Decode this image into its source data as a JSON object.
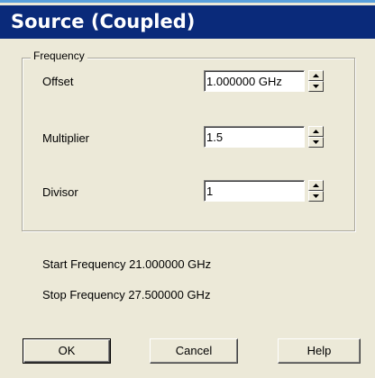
{
  "dialog": {
    "title": "Source (Coupled)"
  },
  "frequency_group": {
    "legend": "Frequency",
    "offset": {
      "label": "Offset",
      "value": "1.000000 GHz"
    },
    "multiplier": {
      "label": "Multiplier",
      "value": "1.5"
    },
    "divisor": {
      "label": "Divisor",
      "value": "1"
    }
  },
  "results": {
    "start": "Start Frequency 21.000000 GHz",
    "stop": "Stop Frequency 27.500000 GHz"
  },
  "buttons": {
    "ok": "OK",
    "cancel": "Cancel",
    "help": "Help"
  },
  "colors": {
    "title_bar": "#0a2a7a",
    "dialog_face": "#ece9d8",
    "top_accent": "#5aa0dc"
  }
}
